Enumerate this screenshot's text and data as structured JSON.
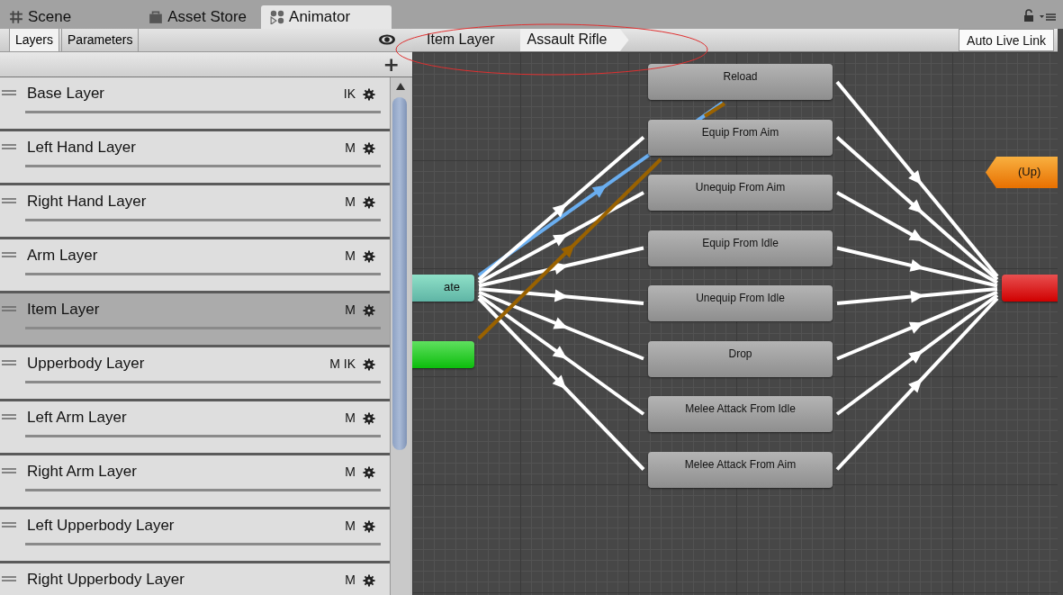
{
  "window_tabs": [
    {
      "label": "Scene",
      "selected": false
    },
    {
      "label": "Asset Store",
      "selected": false
    },
    {
      "label": "Animator",
      "selected": true
    }
  ],
  "panel_tabs": [
    {
      "label": "Layers",
      "selected": true
    },
    {
      "label": "Parameters",
      "selected": false
    }
  ],
  "breadcrumb": [
    "Item Layer",
    "Assault Rifle"
  ],
  "auto_live_link": "Auto Live Link",
  "add_button": "+",
  "layers": [
    {
      "name": "Base Layer",
      "badge": "IK",
      "selected": false
    },
    {
      "name": "Left Hand Layer",
      "badge": "M",
      "selected": false
    },
    {
      "name": "Right Hand Layer",
      "badge": "M",
      "selected": false
    },
    {
      "name": "Arm Layer",
      "badge": "M",
      "selected": false
    },
    {
      "name": "Item Layer",
      "badge": "M",
      "selected": true
    },
    {
      "name": "Upperbody Layer",
      "badge": "M IK",
      "selected": false
    },
    {
      "name": "Left Arm Layer",
      "badge": "M",
      "selected": false
    },
    {
      "name": "Right Arm Layer",
      "badge": "M",
      "selected": false
    },
    {
      "name": "Left Upperbody Layer",
      "badge": "M",
      "selected": false
    },
    {
      "name": "Right Upperbody Layer",
      "badge": "M",
      "selected": false
    }
  ],
  "states": [
    {
      "name": "Reload",
      "kind": "state"
    },
    {
      "name": "Equip From Aim",
      "kind": "state"
    },
    {
      "name": "Unequip From Aim",
      "kind": "state"
    },
    {
      "name": "Equip From Idle",
      "kind": "state"
    },
    {
      "name": "Unequip From Idle",
      "kind": "state"
    },
    {
      "name": "Drop",
      "kind": "state"
    },
    {
      "name": "Melee Attack From Idle",
      "kind": "state"
    },
    {
      "name": "Melee Attack From Aim",
      "kind": "state"
    },
    {
      "name": "ate",
      "kind": "default"
    },
    {
      "kind": "entry"
    },
    {
      "name": "(Up)",
      "kind": "up"
    },
    {
      "kind": "exit"
    }
  ]
}
